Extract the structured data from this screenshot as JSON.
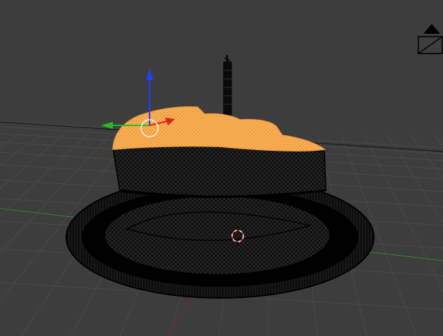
{
  "viewport": {
    "background": "#3d3d3d",
    "grid_color": "#4a4a4a",
    "horizon_color": "#1a1a1a",
    "x_axis_color": "#7a2a2a",
    "y_axis_color": "#2f8a2f"
  },
  "scene": {
    "selected_object_color": "#f0a040",
    "selected_wire_color": "#ffc070",
    "unselected_wire_color": "#000000",
    "objects": [
      "plate-base",
      "cake-body",
      "cake-top-selected",
      "candle"
    ]
  },
  "gizmo": {
    "z_color": "#2040ff",
    "y_color": "#20c020",
    "x_color": "#e02020",
    "rotate_circle_color": "#ffffff"
  },
  "cursor_3d": {
    "ring_color_a": "#ff3030",
    "ring_color_b": "#ffffff"
  },
  "icons": [
    "view-cube-icon",
    "move-gizmo-icon",
    "3d-cursor-icon"
  ]
}
